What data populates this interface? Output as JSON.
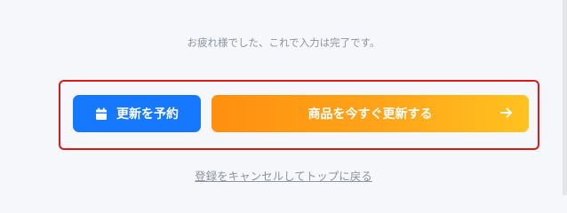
{
  "message": "お疲れ様でした、これで入力は完了です。",
  "buttons": {
    "reserve": {
      "label": "更新を予約",
      "icon": "calendar-icon",
      "color": "#1677ff"
    },
    "update_now": {
      "label": "商品を今すぐ更新する",
      "icon": "arrow-right-icon",
      "gradient_start": "#ff8f0f",
      "gradient_end": "#ffc21f"
    }
  },
  "cancel_link": "登録をキャンセルしてトップに戻る",
  "highlight_color": "#d71a1a"
}
